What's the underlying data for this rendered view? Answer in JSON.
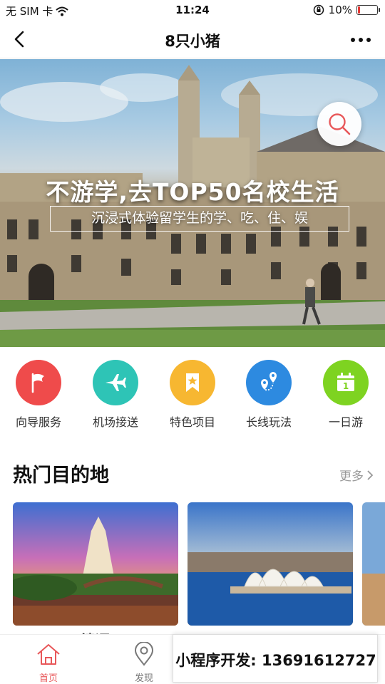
{
  "status_bar": {
    "carrier": "无 SIM 卡",
    "time": "11:24",
    "battery": "10%",
    "battery_level": 0.1
  },
  "nav": {
    "back_icon": "chevron-left-icon",
    "title": "8只小猪",
    "more_icon": "more-dots-icon"
  },
  "banner": {
    "title": "不游学,去TOP50名校生活",
    "subtitle": "沉浸式体验留学生的学、吃、住、娱",
    "search_icon": "search-icon"
  },
  "categories": [
    {
      "label": "向导服务",
      "icon": "flag-icon",
      "color": "#ef4b4b"
    },
    {
      "label": "机场接送",
      "icon": "airplane-icon",
      "color": "#2ec4b6"
    },
    {
      "label": "特色项目",
      "icon": "bookmark-star-icon",
      "color": "#f7b731"
    },
    {
      "label": "长线玩法",
      "icon": "route-pin-icon",
      "color": "#2d8ae0"
    },
    {
      "label": "一日游",
      "icon": "calendar-icon",
      "color": "#7ed321"
    }
  ],
  "section": {
    "title": "热门目的地",
    "more": "更多"
  },
  "destinations": [
    {
      "name": "清迈"
    }
  ],
  "tabs": [
    {
      "label": "首页",
      "icon": "home-icon",
      "active": true
    },
    {
      "label": "发现",
      "icon": "location-pin-icon",
      "active": false
    }
  ],
  "promo": {
    "text": "小程序开发: 13691612727"
  },
  "colors": {
    "accent": "#e8585a",
    "text_muted": "#999999"
  }
}
